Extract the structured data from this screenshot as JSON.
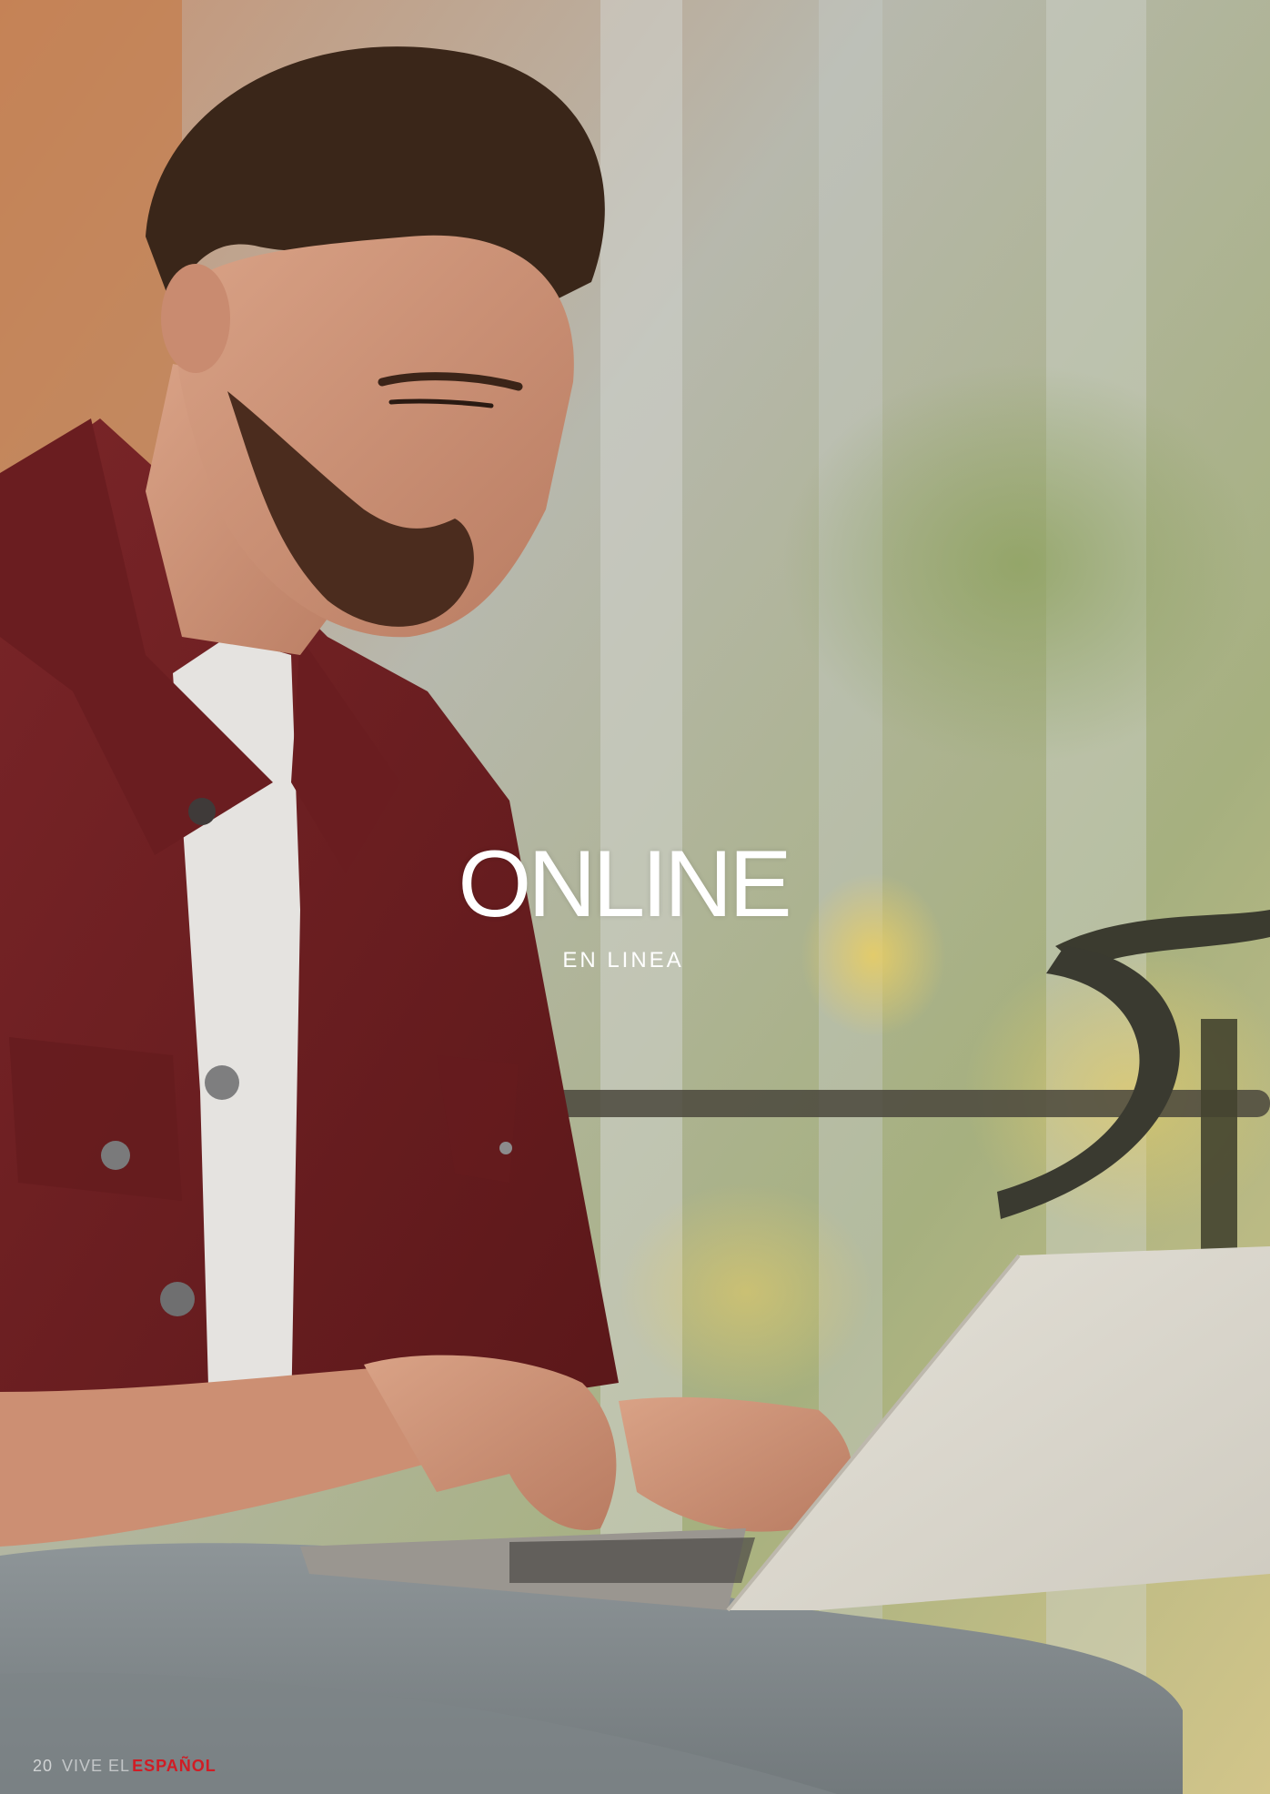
{
  "headline": {
    "title": "ONLINE",
    "subtitle": "EN LINEA"
  },
  "footer": {
    "page_number": "20",
    "brand_light": "VIVE EL",
    "brand_bold": "ESPAÑOL"
  },
  "colors": {
    "jacket": "#6f1f22",
    "brand_red": "#d11c24",
    "title_text": "#ffffff"
  }
}
